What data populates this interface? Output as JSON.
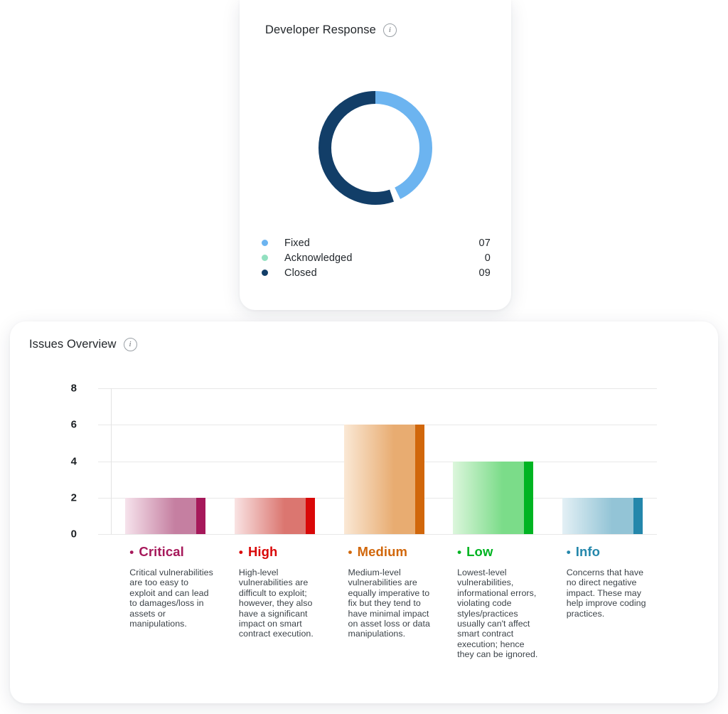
{
  "developer_response": {
    "title": "Developer Response",
    "info_icon": "info-icon",
    "info_glyph": "i",
    "legend": [
      {
        "label": "Fixed",
        "value": "07",
        "color": "#6CB4F0"
      },
      {
        "label": "Acknowledged",
        "value": "0",
        "color": "#92E0C0"
      },
      {
        "label": "Closed",
        "value": "09",
        "color": "#123E68"
      }
    ],
    "chart_data": {
      "type": "pie",
      "title": "Developer Response",
      "variant": "donut",
      "categories": [
        "Fixed",
        "Acknowledged",
        "Closed"
      ],
      "values": [
        7,
        0,
        9
      ],
      "labels": [
        "07",
        "0",
        "09"
      ],
      "colors": [
        "#6CB4F0",
        "#92E0C0",
        "#123E68"
      ],
      "total": 16,
      "legend_position": "bottom",
      "grid": false
    }
  },
  "issues_overview": {
    "title": "Issues Overview",
    "info_icon": "info-icon",
    "info_glyph": "i",
    "chart_data": {
      "type": "bar",
      "title": "Issues Overview",
      "xlabel": "",
      "ylabel": "",
      "categories": [
        "Critical",
        "High",
        "Medium",
        "Low",
        "Info"
      ],
      "values": [
        2,
        2,
        6,
        4,
        2
      ],
      "ylim": [
        0,
        8
      ],
      "yticks": [
        "0",
        "2",
        "4",
        "6",
        "8"
      ],
      "grid": true,
      "legend_position": "none",
      "colors": [
        "#A6185A",
        "#D90808",
        "#D1670B",
        "#00B422",
        "#2487AB"
      ],
      "gradient_from": [
        "#F6E3EC",
        "#F9E3E3",
        "#FAE8D5",
        "#DCF6DC",
        "#E3F0F5"
      ],
      "gradient_to": [
        "#C57FA1",
        "#DB7670",
        "#E8AC71",
        "#7BDC89",
        "#93C4D6"
      ]
    },
    "categories": [
      {
        "name": "Critical",
        "color": "#A6185A",
        "bullet": "•",
        "description": "Critical vulnerabilities are too easy to exploit and can lead to damages/loss in assets or manipulations."
      },
      {
        "name": "High",
        "color": "#D90808",
        "bullet": "•",
        "description": "High-level vulnerabilities are difficult to exploit; however, they also have a significant impact on smart contract execution."
      },
      {
        "name": "Medium",
        "color": "#D1670B",
        "bullet": "•",
        "description": "Medium-level vulnerabilities are equally imperative to fix but they tend to have minimal impact on asset loss or data manipulations."
      },
      {
        "name": "Low",
        "color": "#00B422",
        "bullet": "•",
        "description": "Lowest-level vulnerabilities, informational errors, violating code styles/practices usually can't affect smart contract execution; hence they can be ignored."
      },
      {
        "name": "Info",
        "color": "#2487AB",
        "bullet": "•",
        "description": "Concerns that have no direct negative impact. These may help improve coding practices."
      }
    ]
  }
}
